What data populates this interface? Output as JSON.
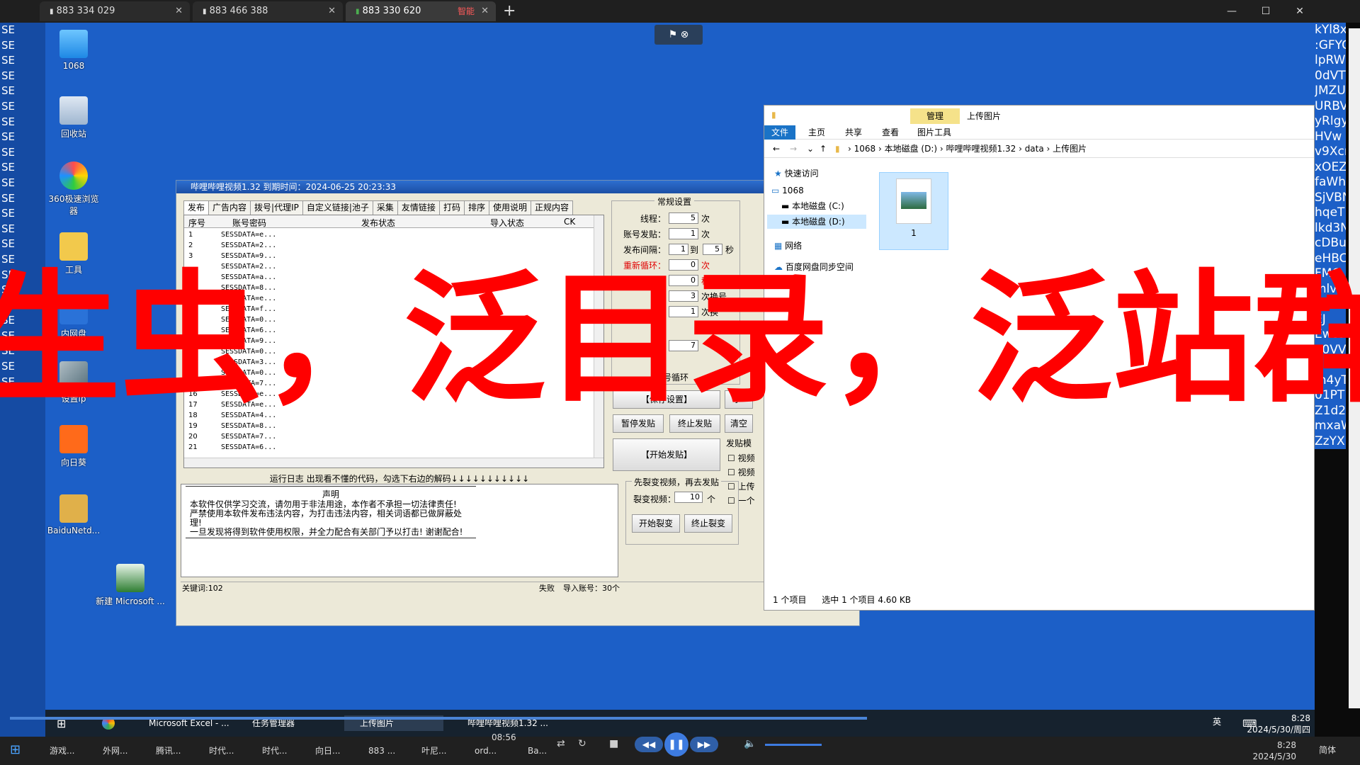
{
  "outer_tabs": [
    {
      "label": "883 334 029"
    },
    {
      "label": "883 466 388"
    },
    {
      "label": "883 330 620",
      "badge": "智能"
    }
  ],
  "left_strip_text": "SE",
  "right_strip_lines": [
    "kYl8x",
    ":GFYC",
    "lpRW",
    "0dVT",
    "JMZU",
    "URBV",
    "yRlgy",
    "HVw",
    "v9Xcr",
    "xOEZ",
    "faWh",
    "SjVBN",
    "hqeT",
    "lkd3N",
    "cDBu",
    "eHBC",
    "FMG",
    "mlv",
    "pbnd",
    "EJ",
    "EwtU",
    "a0VV",
    "UGk",
    "m4yT",
    "01PT",
    "Z1d2",
    "mxaW",
    "ZzYX"
  ],
  "desktop_icons": [
    "1068",
    "回收站",
    "360极速浏览器",
    "工具",
    "内网盘",
    "设置ip",
    "向日葵",
    "BaiduNetd...",
    "新建 Microsoft ..."
  ],
  "app": {
    "title": "哔哩哔哩视频1.32    到期时间：2024-06-25 20:23:33",
    "tabs": [
      "发布",
      "广告内容",
      "拨号|代理IP",
      "自定义链接|池子",
      "采集",
      "友情链接",
      "打码",
      "排序",
      "使用说明",
      "正规内容"
    ],
    "grid_headers": [
      "序号",
      "账号密码",
      "发布状态",
      "导入状态",
      "CK"
    ],
    "rows": [
      {
        "n": "1",
        "s": "SESSDATA=e..."
      },
      {
        "n": "2",
        "s": "SESSDATA=2..."
      },
      {
        "n": "3",
        "s": "SESSDATA=9..."
      },
      {
        "n": "",
        "s": "SESSDATA=2..."
      },
      {
        "n": "",
        "s": "SESSDATA=a..."
      },
      {
        "n": "",
        "s": "SESSDATA=8..."
      },
      {
        "n": "",
        "s": "SESSDATA=e..."
      },
      {
        "n": "",
        "s": "SESSDATA=f..."
      },
      {
        "n": "",
        "s": "SESSDATA=0..."
      },
      {
        "n": "",
        "s": "SESSDATA=6..."
      },
      {
        "n": "",
        "s": "SESSDATA=9..."
      },
      {
        "n": "",
        "s": "SESSDATA=0..."
      },
      {
        "n": "",
        "s": "SESSDATA=3..."
      },
      {
        "n": "",
        "s": "SESSDATA=0..."
      },
      {
        "n": "",
        "s": "SESSDATA=7..."
      },
      {
        "n": "16",
        "s": "SESSDATA=e..."
      },
      {
        "n": "17",
        "s": "SESSDATA=e..."
      },
      {
        "n": "18",
        "s": "SESSDATA=4..."
      },
      {
        "n": "19",
        "s": "SESSDATA=8..."
      },
      {
        "n": "20",
        "s": "SESSDATA=7..."
      },
      {
        "n": "21",
        "s": "SESSDATA=6..."
      }
    ],
    "config": {
      "title": "常规设置",
      "threads_label": "线程：",
      "threads": "5",
      "threads_unit": "次",
      "per_account_label": "账号发贴：",
      "per_account": "1",
      "per_account_unit": "次",
      "interval_label": "发布间隔：",
      "interval_from": "1",
      "interval_to_label": "到",
      "interval_to": "5",
      "interval_unit": "秒",
      "reloop_label": "重新循环：",
      "reloop": "0",
      "reloop_unit": "次",
      "loop_value": "0",
      "loop_unit": "秒",
      "login_value": "3",
      "login_unit": "次换号",
      "post_value": "1",
      "post_unit": "次换",
      "keyword_value": "7",
      "account_loop_label": "账号循环"
    },
    "buttons": {
      "save": "【保存设置】",
      "pause": "暂停发贴",
      "stop": "终止发贴",
      "clear": "清空",
      "start": "【开始发贴】",
      "start_split": "开始裂变",
      "stop_split": "终止裂变"
    },
    "post_mode_label": "发贴模",
    "checkboxes": [
      "视频",
      "视频",
      "上传",
      "一个"
    ],
    "log_caption": "运行日志 出现看不懂的代码，勾选下右边的解码↓↓↓↓↓↓↓↓↓↓↓",
    "log_heading": "声明",
    "log_lines": [
      "本软件仅供学习交流，请勿用于非法用途，本作者不承担一切法律责任!",
      "严禁使用本软件发布违法内容，为打击违法内容，相关词语都已做屏蔽处理!",
      "一旦发现将得到软件使用权限，并全力配合有关部门予以打击! 谢谢配合!"
    ],
    "split_title": "先裂变视频，再去发贴",
    "split_label": "裂变视频：",
    "split_value": "10",
    "split_unit": "个",
    "status_keywords": "关键词:102",
    "status_fail": "失败",
    "status_import": "导入账号：30个"
  },
  "explorer": {
    "manage_tab": "管理",
    "title": "上传图片",
    "ribbon_tabs": [
      "文件",
      "主页",
      "共享",
      "查看",
      "图片工具"
    ],
    "path": [
      "1068",
      "本地磁盘 (D:)",
      "哔哩哔哩视频1.32",
      "data",
      "上传图片"
    ],
    "nav": [
      "快速访问",
      "1068",
      "本地磁盘 (C:)",
      "本地磁盘 (D:)",
      "网络",
      "百度网盘同步空间"
    ],
    "file_name": "1",
    "status_count": "1 个项目",
    "status_selected": "选中 1 个项目  4.60 KB"
  },
  "overlay_text": "生虫，泛目录，泛站群",
  "remote_taskbar": [
    "Microsoft Excel - ...",
    "任务管理器",
    "上传图片",
    "哔哩哔哩视频1.32 ..."
  ],
  "remote_clock": {
    "time": "8:28",
    "date": "2024/5/30/周四"
  },
  "local_taskbar": [
    "游戏...",
    "外网...",
    "腾讯...",
    "时代...",
    "时代...",
    "向日...",
    "883 ...",
    "叶尼...",
    "ord...",
    "Ba..."
  ],
  "local_clock": {
    "time": "8:28",
    "date": "2024/5/30"
  },
  "player_time": "08:56",
  "ime_label": "英",
  "lang_label": "简体",
  "colors": {
    "desktop": "#1c5fc7",
    "overlay": "#ff0000",
    "accent": "#1c4fa5"
  }
}
